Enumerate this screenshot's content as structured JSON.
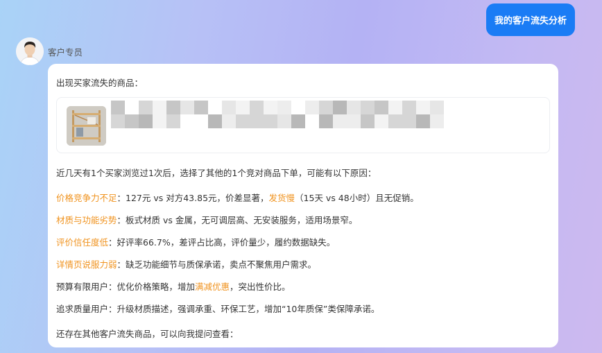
{
  "user_message": "我的客户流失分析",
  "agent": {
    "name": "客户专员",
    "avatar": "avatar-photo"
  },
  "response": {
    "intro": "出现买家流失的商品：",
    "product": {
      "image": "wooden-shelf-thumbnail",
      "title_blurred": true
    },
    "summary": "近几天有1个买家浏览过1次后，选择了其他的1个竞对商品下单，可能有以下原因：",
    "reasons": [
      {
        "label": "价格竞争力不足",
        "text_a": "：127元 vs 对方43.85元，价差显著，",
        "label2": "发货慢",
        "text_b": "（15天 vs 48小时）且无促销。"
      },
      {
        "label": "材质与功能劣势",
        "text": "：板式材质 vs 金属，无可调层高、无安装服务，适用场景窄。"
      },
      {
        "label": "评价信任度低",
        "text": "：好评率66.7%，差评占比高，评价量少，履约数据缺失。"
      },
      {
        "label": "详情页说服力弱",
        "text": "：缺乏功能细节与质保承诺，卖点不聚焦用户需求。"
      }
    ],
    "suggestions": [
      {
        "text_a": "预算有限用户：优化价格策略，增加",
        "highlight": "满减优惠",
        "text_b": "，突出性价比。"
      },
      {
        "text": "追求质量用户：升级材质描述，强调承重、环保工艺，增加“10年质保”类保障承诺。"
      }
    ],
    "closing": "还存在其他客户流失商品，可以向我提问查看："
  },
  "colors": {
    "user_bubble": "#1a7cf5",
    "highlight": "#f0931f",
    "text": "#333333"
  }
}
